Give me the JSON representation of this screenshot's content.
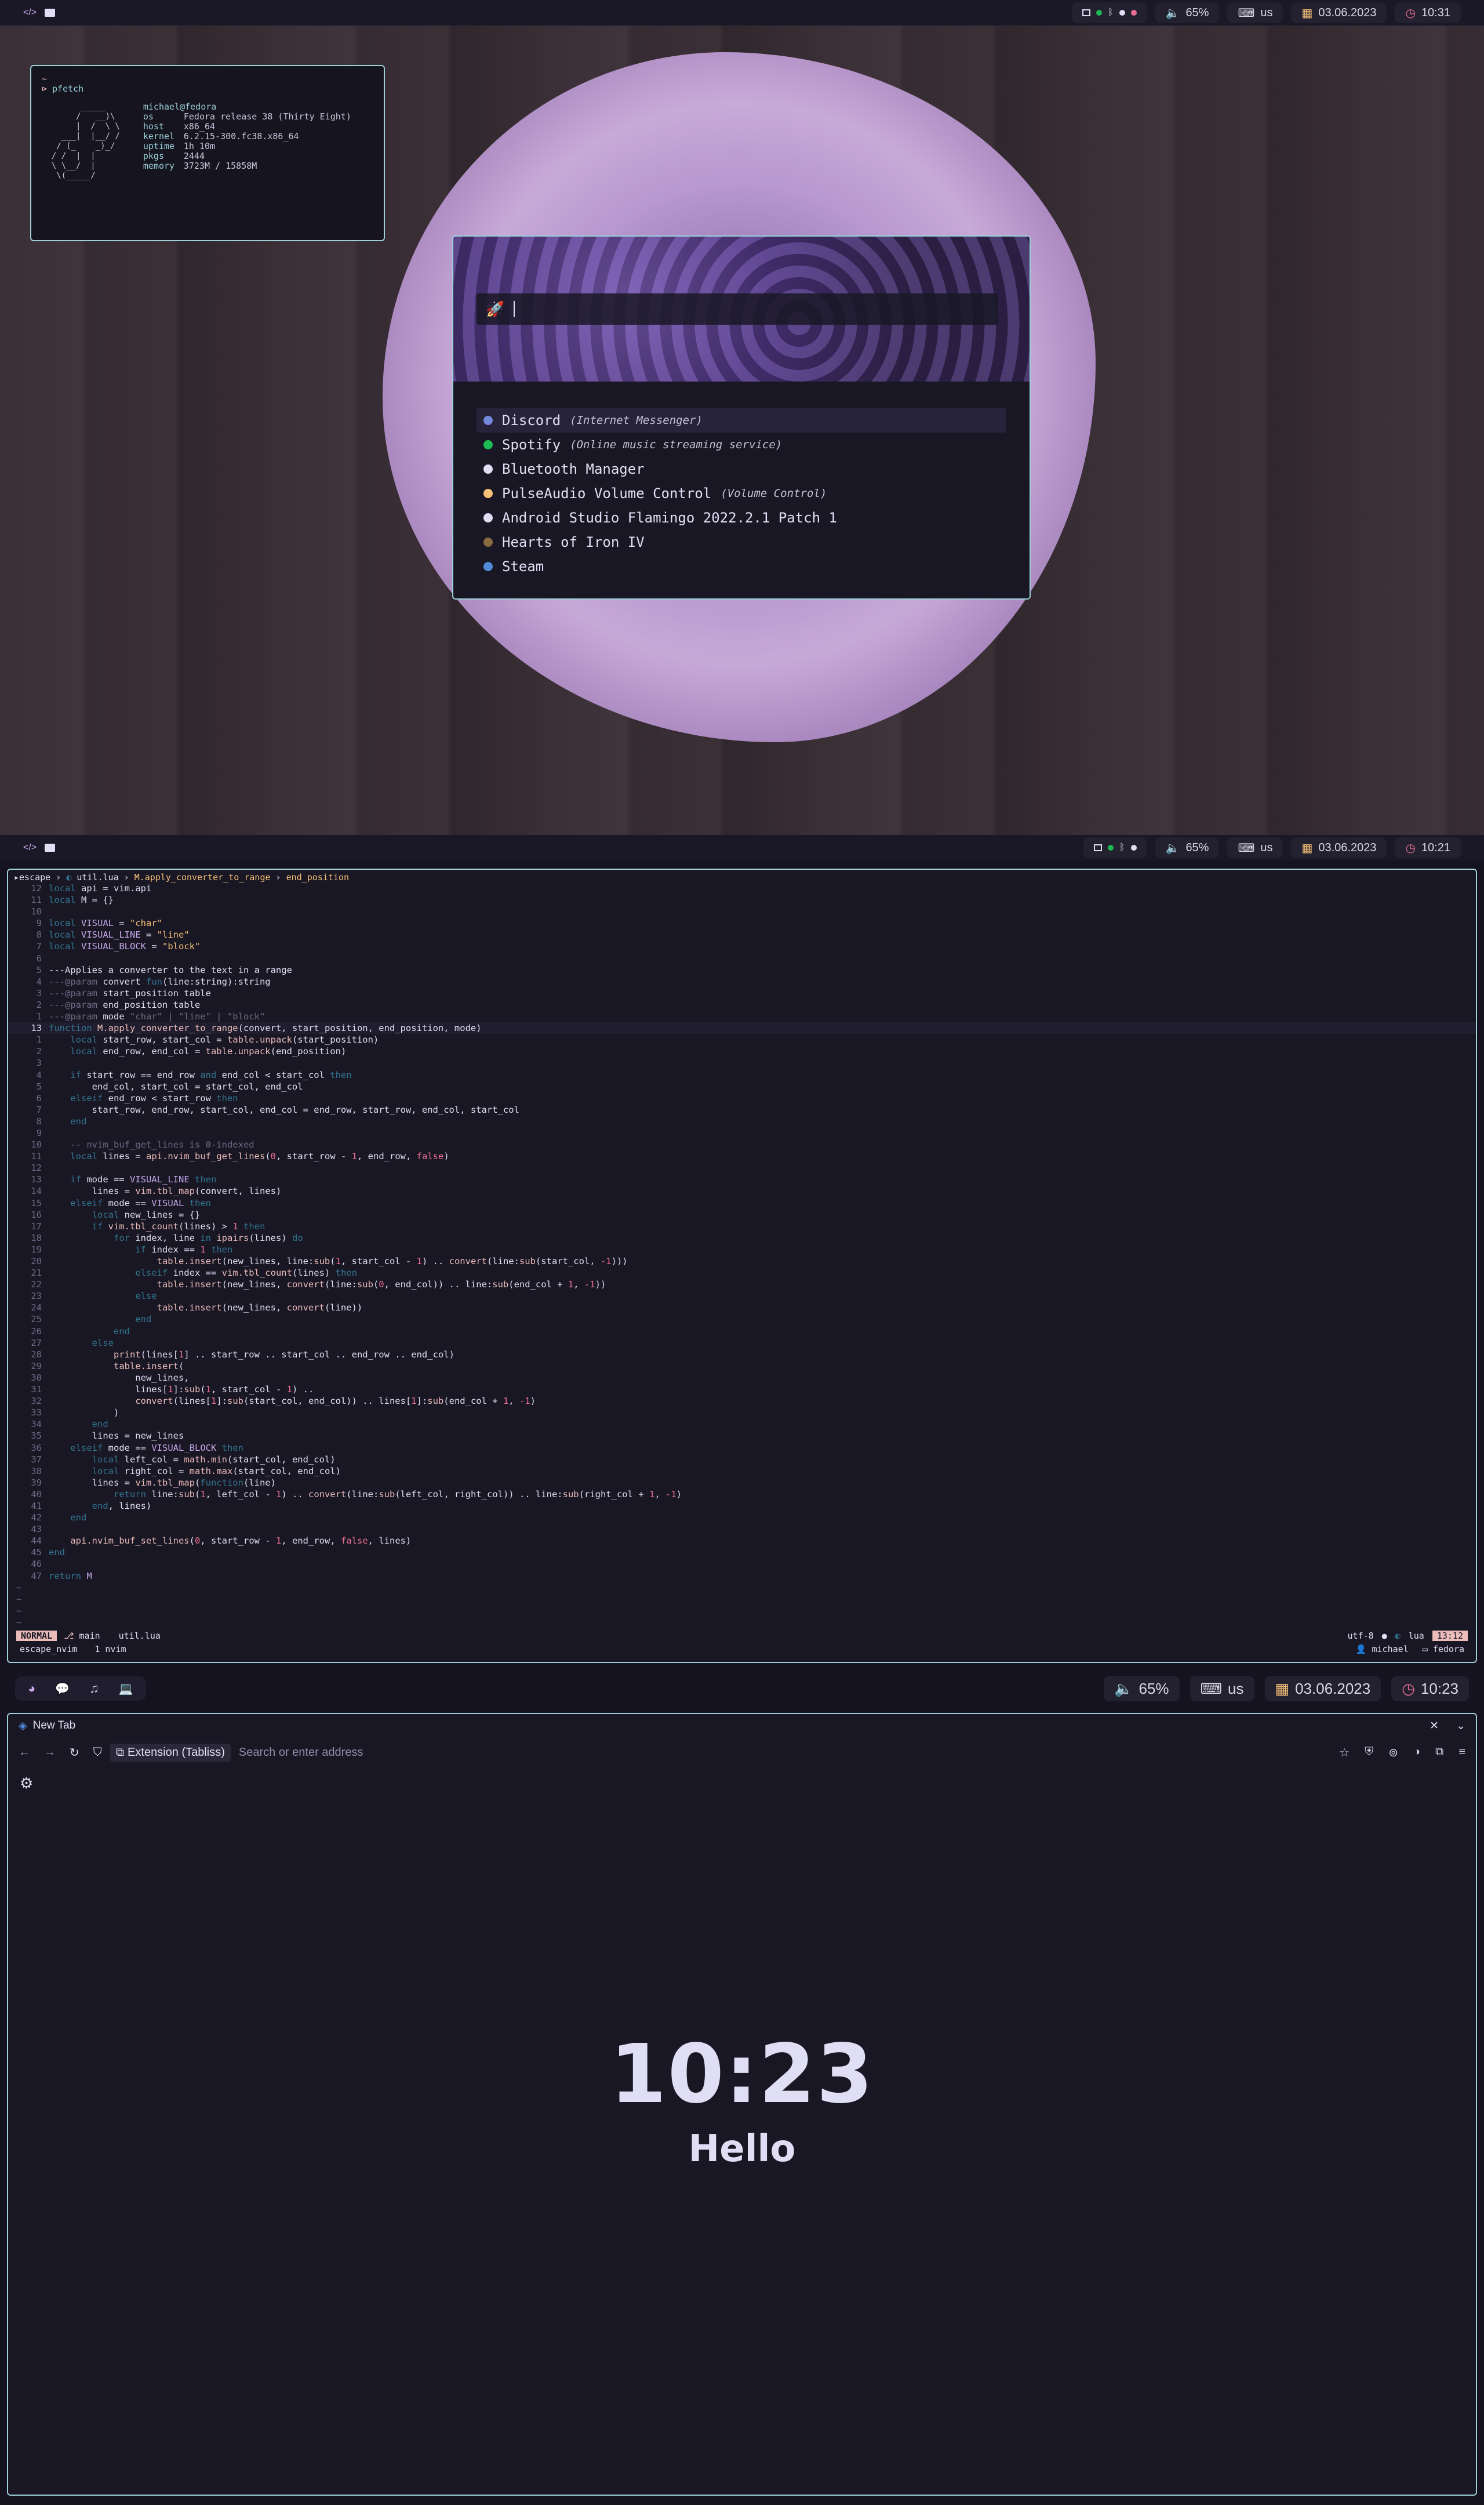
{
  "screen1": {
    "bar": {
      "left_icons": [
        "code-icon",
        "terminal-icon"
      ],
      "volume": "65%",
      "layout": "us",
      "date": "03.06.2023",
      "time": "10:31"
    },
    "pfetch": {
      "prompt": "~",
      "command": "pfetch",
      "user": "michael@fedora",
      "rows": [
        {
          "k": "os",
          "v": "Fedora release 38 (Thirty Eight)"
        },
        {
          "k": "host",
          "v": "x86_64"
        },
        {
          "k": "kernel",
          "v": "6.2.15-300.fc38.x86_64"
        },
        {
          "k": "uptime",
          "v": "1h 10m"
        },
        {
          "k": "pkgs",
          "v": "2444"
        },
        {
          "k": "memory",
          "v": "3723M / 15858M"
        }
      ]
    },
    "launcher": {
      "items": [
        {
          "name": "Discord",
          "desc": "(Internet Messenger)",
          "color": "#7289da"
        },
        {
          "name": "Spotify",
          "desc": "(Online music streaming service)",
          "color": "#1db954"
        },
        {
          "name": "Bluetooth Manager",
          "desc": "",
          "color": "#e0def4"
        },
        {
          "name": "PulseAudio Volume Control",
          "desc": "(Volume Control)",
          "color": "#f6c177"
        },
        {
          "name": "Android Studio Flamingo 2022.2.1 Patch 1",
          "desc": "",
          "color": "#e0def4"
        },
        {
          "name": "Hearts of Iron IV",
          "desc": "",
          "color": "#8a6b3e"
        },
        {
          "name": "Steam",
          "desc": "",
          "color": "#4f8ad9"
        }
      ]
    }
  },
  "screen2": {
    "bar": {
      "volume": "65%",
      "layout": "us",
      "date": "03.06.2023",
      "time": "10:21"
    },
    "winbar": {
      "dir": "escape",
      "file": "util.lua",
      "func": "M.apply_converter_to_range",
      "sym": "end_position"
    },
    "status": {
      "mode": "NORMAL",
      "branch": "main",
      "file": "util.lua",
      "encoding": "utf-8",
      "ft": "lua",
      "pos": "13:12"
    },
    "status2": {
      "session": "escape_nvim",
      "win": "1 nvim",
      "user": "michael",
      "host": "fedora"
    }
  },
  "screen3": {
    "bar": {
      "volume": "65%",
      "layout": "us",
      "date": "03.06.2023",
      "time": "10:23"
    },
    "tab_title": "New Tab",
    "ext_label": "Extension (Tabliss)",
    "url_placeholder": "Search or enter address",
    "clock": "10:23",
    "greeting": "Hello"
  }
}
